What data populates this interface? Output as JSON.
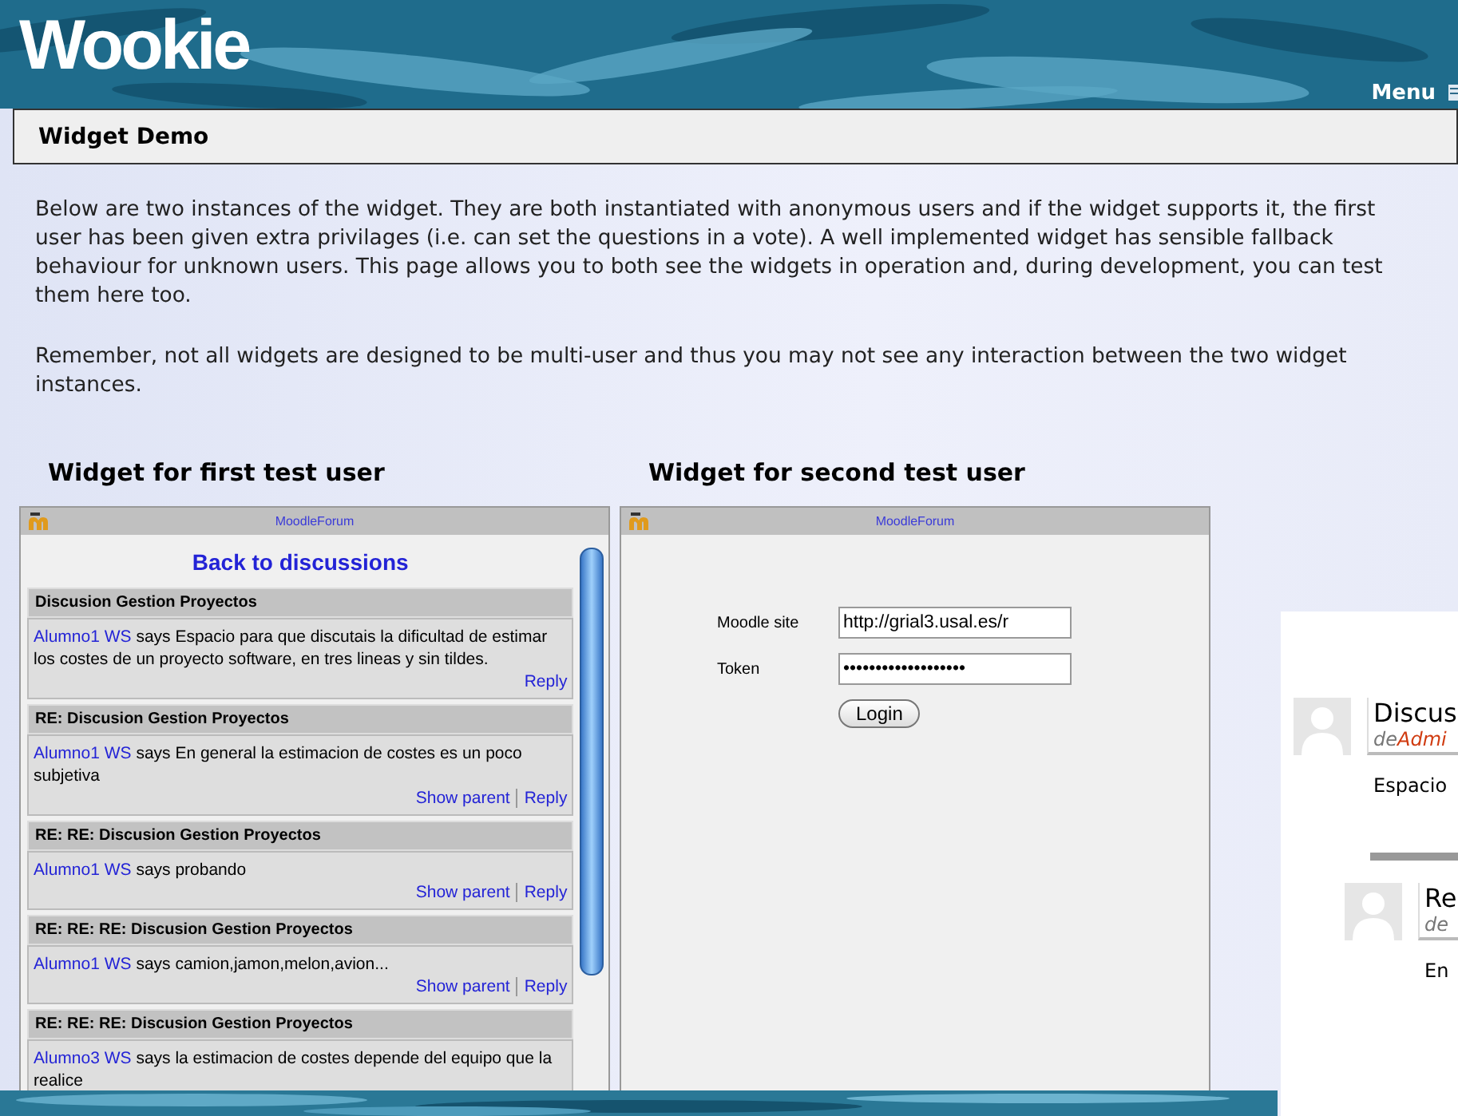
{
  "header": {
    "logo": "Wookie",
    "menu": "Menu"
  },
  "page_title": "Widget Demo",
  "paragraphs": [
    "Below are two instances of the widget. They are both instantiated with anonymous users and if the widget supports it, the first user has been given extra privilages (i.e. can set the questions in a vote). A well implemented widget has sensible fallback behaviour for unknown users. This page allows you to both see the widgets in operation and, during development, you can test them here too.",
    "Remember, not all widgets are designed to be multi-user and thus you may not see any interaction between the two widget instances."
  ],
  "widgets": [
    {
      "heading": "Widget for first test user",
      "title": "MoodleForum",
      "kind": "forum",
      "back_link": "Back to discussions",
      "posts": [
        {
          "title": "Discusion Gestion Proyectos",
          "author": "Alumno1 WS",
          "text": "says Espacio para que discutais la dificultad de estimar los costes de un proyecto software, en tres lineas y sin tildes.",
          "actions": [
            "Reply"
          ]
        },
        {
          "title": "RE: Discusion Gestion Proyectos",
          "author": "Alumno1 WS",
          "text": "says En general la estimacion de costes es un poco subjetiva",
          "actions": [
            "Show parent",
            "Reply"
          ]
        },
        {
          "title": "RE: RE: Discusion Gestion Proyectos",
          "author": "Alumno1 WS",
          "text": "says probando",
          "actions": [
            "Show parent",
            "Reply"
          ]
        },
        {
          "title": "RE: RE: RE: Discusion Gestion Proyectos",
          "author": "Alumno1 WS",
          "text": "says camion,jamon,melon,avion...",
          "actions": [
            "Show parent",
            "Reply"
          ]
        },
        {
          "title": "RE: RE: RE: Discusion Gestion Proyectos",
          "author": "Alumno3 WS",
          "text": "says la estimacion de costes depende del equipo que la realice"
        }
      ]
    },
    {
      "heading": "Widget for second test user",
      "title": "MoodleForum",
      "kind": "login",
      "fields": [
        {
          "label": "Moodle site",
          "value": "http://grial3.usal.es/r"
        },
        {
          "label": "Token",
          "value": "•••••••••••••••••••"
        }
      ],
      "button": "Login"
    }
  ],
  "inset": {
    "posts": [
      {
        "title": "Discus",
        "by": "de",
        "author": "Admi",
        "body": "Espacio"
      },
      {
        "title": "Re",
        "by": "de",
        "body": "En"
      }
    ]
  }
}
